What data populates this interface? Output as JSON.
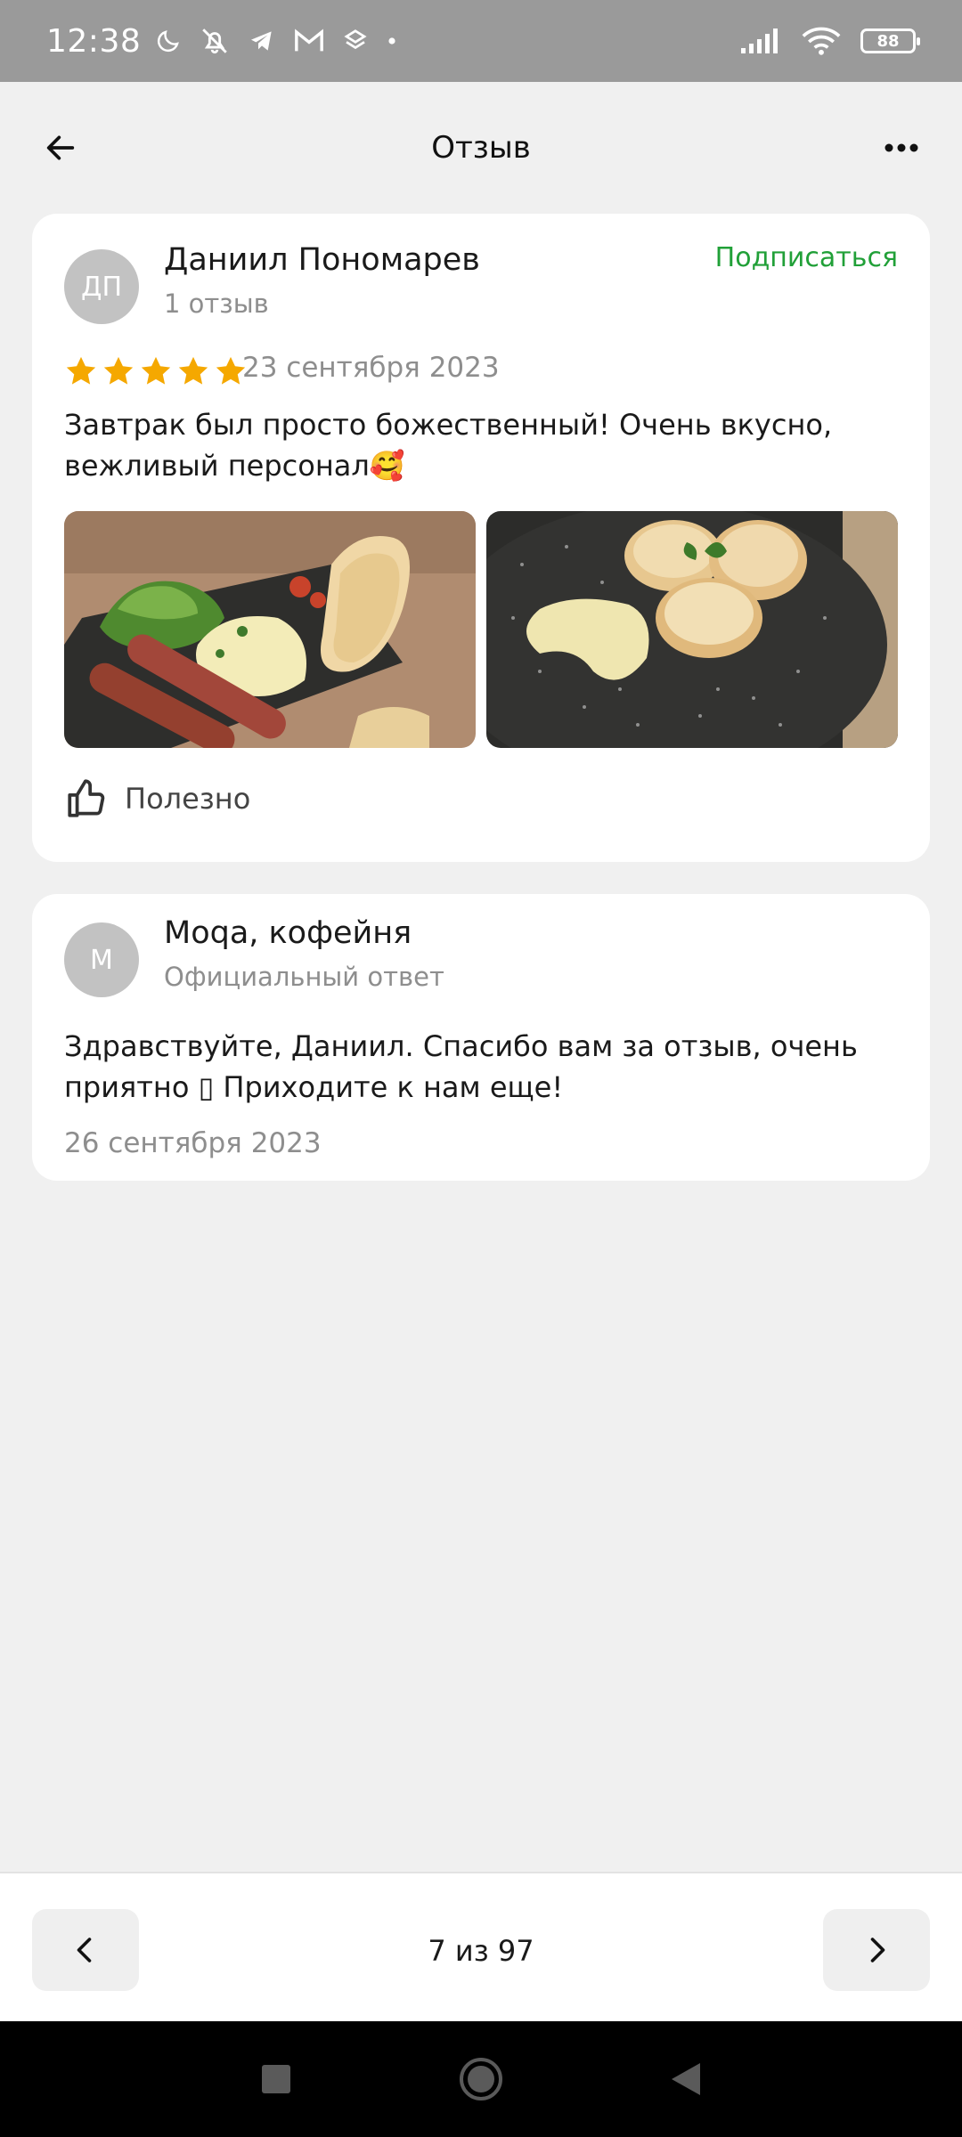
{
  "status_bar": {
    "time": "12:38",
    "battery": "88",
    "icons": [
      "moon-icon",
      "bell-off-icon",
      "telegram-icon",
      "gmail-icon",
      "dropbox-icon",
      "dot-icon",
      "signal-icon",
      "wifi-icon",
      "battery-icon"
    ]
  },
  "header": {
    "title": "Отзыв",
    "back_icon": "arrow-left-icon",
    "menu_icon": "more-horizontal-icon"
  },
  "review": {
    "avatar_initials": "ДП",
    "author": "Даниил Пономарев",
    "reviews_count": "1 отзыв",
    "subscribe_label": "Подписаться",
    "rating": 5,
    "rating_max": 5,
    "date": "23 сентября 2023",
    "text": "Завтрак был просто божественный! Очень вкусно, вежливый персонал🥰",
    "photos": [
      "breakfast-plate-photo",
      "syrniki-photo"
    ],
    "useful_label": "Полезно",
    "accent_color": "#21a038",
    "star_color": "#f5a800"
  },
  "reply": {
    "avatar_initials": "М",
    "author": "Moqa, кофейня",
    "subtitle": "Официальный ответ",
    "text": "Здравствуйте, Даниил. Спасибо вам за отзыв, очень приятно ▯ Приходите к нам еще!",
    "date": "26 сентября 2023"
  },
  "pager": {
    "counter": "7 из 97"
  }
}
